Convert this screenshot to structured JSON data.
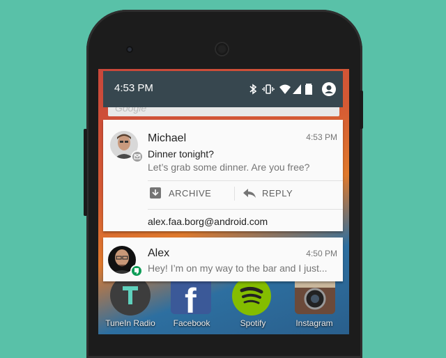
{
  "status_bar": {
    "time": "4:53 PM",
    "icons": [
      "bluetooth-icon",
      "vibrate-icon",
      "wifi-icon",
      "signal-icon",
      "battery-icon",
      "account-icon"
    ]
  },
  "home": {
    "search_hint": "Google",
    "apps": [
      {
        "label": "TuneIn Radio"
      },
      {
        "label": "Facebook"
      },
      {
        "label": "Spotify"
      },
      {
        "label": "Instagram"
      }
    ]
  },
  "notifications": [
    {
      "sender": "Michael",
      "time": "4:53 PM",
      "title": "Dinner tonight?",
      "text": "Let’s grab some dinner. Are you free?",
      "actions": [
        {
          "label": "ARCHIVE",
          "icon": "archive-icon"
        },
        {
          "label": "REPLY",
          "icon": "reply-icon"
        }
      ],
      "account": "alex.faa.borg@android.com",
      "badge_icon": "email-icon",
      "badge_color": "#9e9e9e"
    },
    {
      "sender": "Alex",
      "time": "4:50 PM",
      "text": "Hey! I’m on my way to the bar and I just...",
      "badge_icon": "hangouts-icon",
      "badge_color": "#0f9d58"
    }
  ],
  "colors": {
    "background": "#59c1a8",
    "status_bar": "#37474f",
    "card": "#fafafa"
  }
}
